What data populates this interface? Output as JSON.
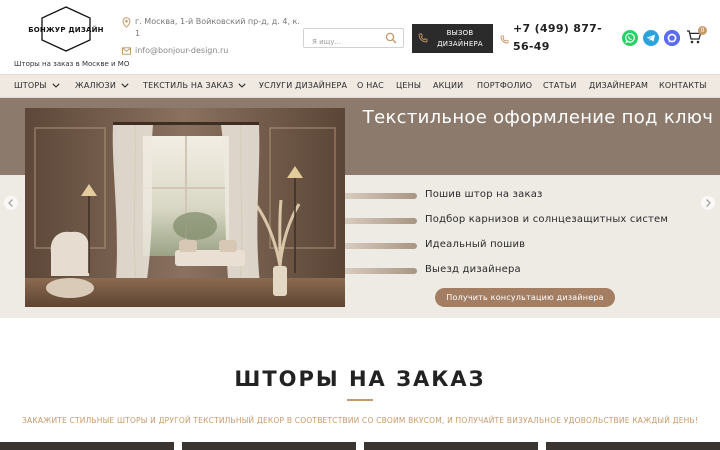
{
  "header": {
    "logo_text": "БОНЖУР ДИЗАЙН",
    "tagline": "Шторы на заказ в Москве и МО",
    "address": "г. Москва, 1-й Войковский пр-д, д. 4, к. 1",
    "email": "info@bonjour-design.ru",
    "search_placeholder": "Я ищу...",
    "call_button": "ВЫЗОВ ДИЗАЙНЕРА",
    "phone": "+7 (499) 877-56-49",
    "cart_count": "0",
    "icons": {
      "location": "location-pin-icon",
      "email": "email-icon",
      "search": "search-icon",
      "phone": "phone-icon",
      "whatsapp": "whatsapp-icon",
      "telegram": "telegram-icon",
      "max": "max-messenger-icon",
      "cart": "cart-icon"
    }
  },
  "nav": {
    "items": [
      {
        "label": "ШТОРЫ"
      },
      {
        "label": "ЖАЛЮЗИ"
      },
      {
        "label": "ТЕКСТИЛЬ НА ЗАКАЗ"
      },
      {
        "label": "УСЛУГИ ДИЗАЙНЕРА"
      },
      {
        "label": "О НАС"
      },
      {
        "label": "ЦЕНЫ"
      },
      {
        "label": "АКЦИИ"
      },
      {
        "label": "ПОРТФОЛИО"
      },
      {
        "label": "СТАТЬИ"
      },
      {
        "label": "ДИЗАЙНЕРАМ"
      },
      {
        "label": "КОНТАКТЫ"
      }
    ]
  },
  "hero": {
    "title": "Текстильное оформление под ключ",
    "features": [
      "Пошив штор на заказ",
      "Подбор карнизов и солнцезащитных систем",
      "Идеальный пошив",
      "Выезд дизайнера"
    ],
    "cta": "Получить консультацию дизайнера"
  },
  "section": {
    "title": "ШТОРЫ НА ЗАКАЗ",
    "subtitle": "ЗАКАЖИТЕ СТИЛЬНЫЕ ШТОРЫ И ДРУГОЙ ТЕКСТИЛЬНЫЙ ДЕКОР В СООТВЕТСТВИИ СО СВОИМ ВКУСОМ, И ПОЛУЧАЙТЕ ВИЗУАЛЬНОЕ УДОВОЛЬСТВИЕ КАЖДЫЙ ДЕНЬ!"
  },
  "colors": {
    "accent": "#c79a6b",
    "dark": "#2b2b2b",
    "hero_band": "#8c7b6c",
    "cta": "#a47e62",
    "whatsapp": "#25d366",
    "telegram": "#2aa3dc",
    "max": "#7b3fe4"
  }
}
